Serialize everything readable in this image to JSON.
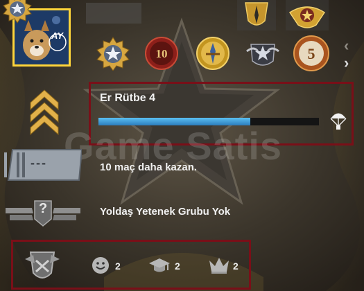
{
  "profile": {
    "rank_name": "Er Rütbe 4",
    "rank_progress": 0.69,
    "wins_needed_text": "10 maç daha kazan.",
    "skill_group_text": "Yoldaş Yetenek Grubu Yok",
    "watermark_text": "Game Satis",
    "avatar_initials": "AY",
    "medal_10_label": "10",
    "medal_5_label": "5",
    "wingman_badge_text": "---",
    "skill_unknown_text": "?"
  },
  "commendations": {
    "friendly": "2",
    "teacher": "2",
    "leader": "2"
  },
  "colors": {
    "avatar_border": "#ffd53a",
    "highlight_border": "#7a0f18",
    "progress_fill": "#3a9ad8",
    "rank_chevron": "#e2b14a"
  },
  "icons": [
    "coin-star-icon",
    "medal-star-icon",
    "medal-10-icon",
    "medal-dagger-icon",
    "medal-eagle-icon",
    "medal-5-icon",
    "rank-chevron-icon",
    "parachute-icon",
    "wingman-badge-icon",
    "skill-group-wings-icon",
    "squad-crest-icon",
    "smiley-icon",
    "grad-cap-icon",
    "crown-icon",
    "chevron-up-icon",
    "chevron-right-icon"
  ]
}
